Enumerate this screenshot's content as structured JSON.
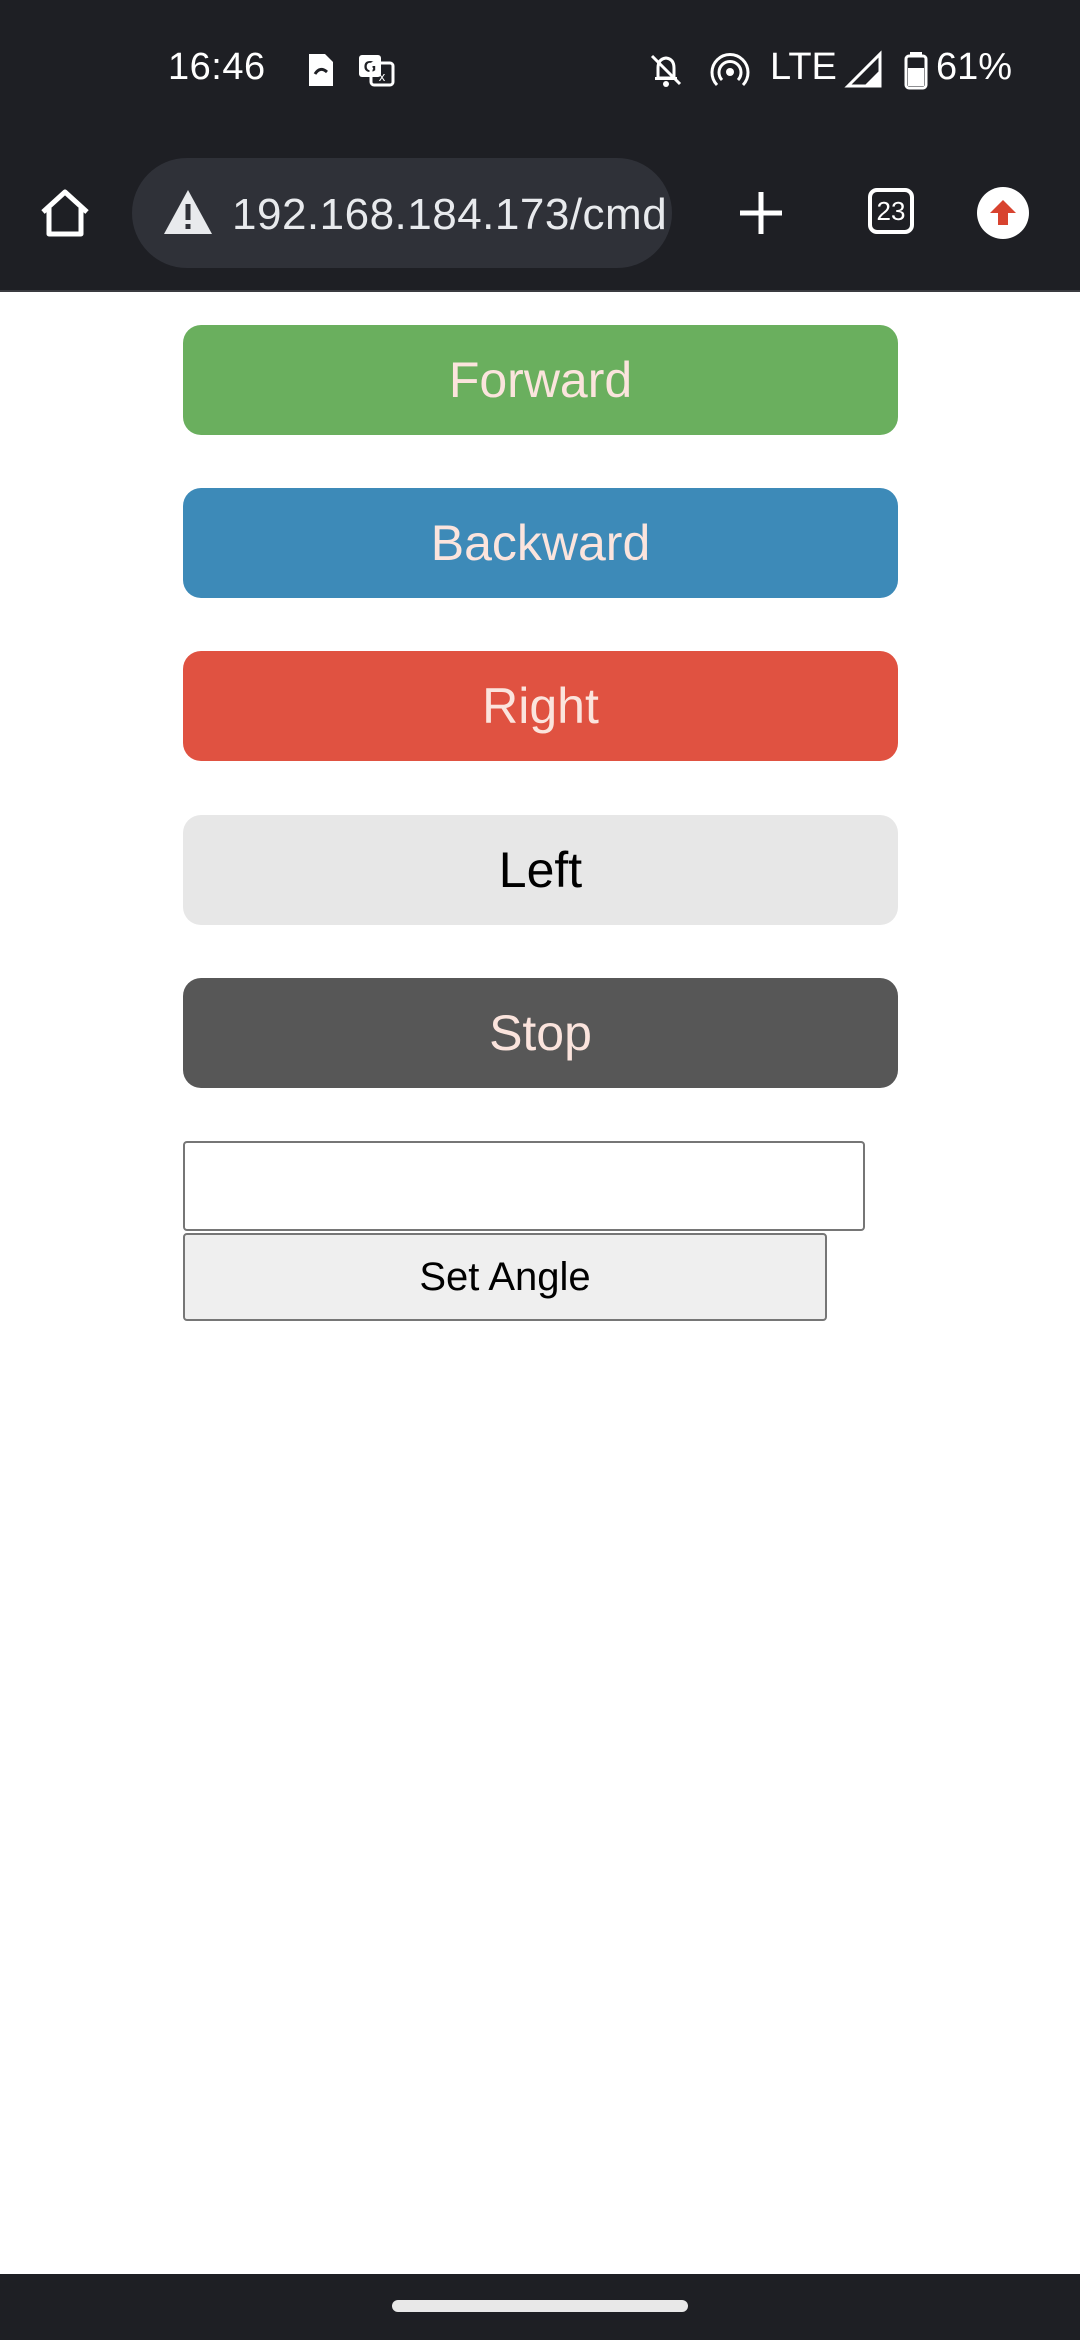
{
  "status_bar": {
    "time": "16:46",
    "network": "LTE",
    "battery": "61%",
    "icons": [
      "sim-card-icon",
      "translate-icon",
      "notifications-off-icon",
      "hotspot-icon",
      "signal-icon",
      "battery-icon"
    ]
  },
  "browser": {
    "url": "192.168.184.173/cmd",
    "tab_count": "23",
    "icons": [
      "home-icon",
      "warning-icon",
      "new-tab-icon",
      "tabs-icon",
      "update-icon"
    ]
  },
  "controls": {
    "forward": {
      "label": "Forward",
      "color": "#6aaf5e"
    },
    "backward": {
      "label": "Backward",
      "color": "#3d8ab8"
    },
    "right": {
      "label": "Right",
      "color": "#e05241"
    },
    "left": {
      "label": "Left",
      "color": "#e7e7e7"
    },
    "stop": {
      "label": "Stop",
      "color": "#575757"
    }
  },
  "angle_form": {
    "input_value": "",
    "button_label": "Set Angle"
  }
}
